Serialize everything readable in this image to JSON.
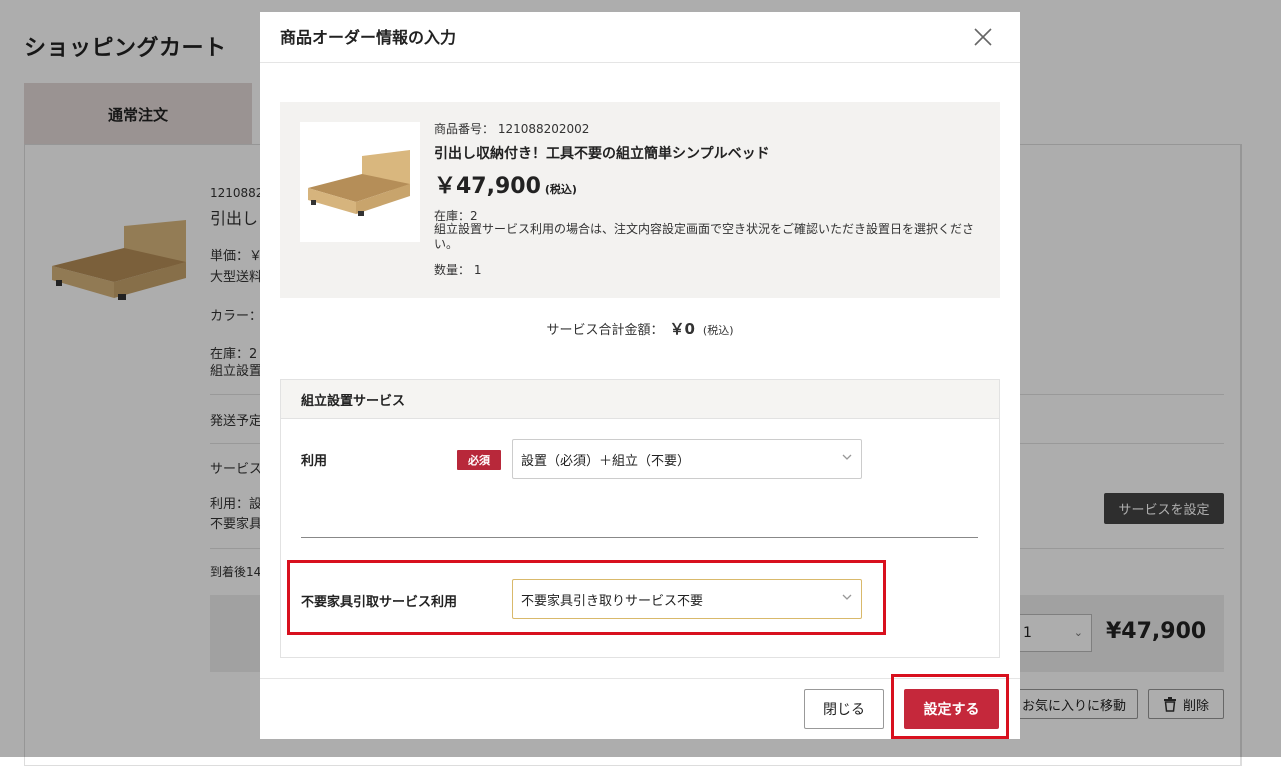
{
  "page": {
    "title": "ショッピングカート",
    "tab_normal": "通常注文",
    "item_number_partial": "1210882",
    "item_name_partial": "引出し",
    "unit_price_label": "単価：￥",
    "shipping_partial": "大型送料",
    "color_label": "カラー：",
    "stock_partial": "在庫：2",
    "assembly_partial": "組立設置",
    "ship_schedule_partial": "発送予定",
    "service_partial": "サービス",
    "usage_partial": "利用：設",
    "disposal_partial": "不要家具",
    "after_arrival_partial": "到着後14",
    "set_service_button": "サービスを設定",
    "qty_value": "1",
    "price": "¥47,900",
    "favorite_button": "お気に入りに移動",
    "delete_button": "削除"
  },
  "modal": {
    "title": "商品オーダー情報の入力",
    "product": {
      "number": "商品番号： 121088202002",
      "name": "引出し収納付き！工具不要の組立簡単シンプルベッド",
      "price": "￥47,900",
      "price_tax": "(税込)",
      "stock": "在庫：2",
      "note": "組立設置サービス利用の場合は、注文内容設定画面で空き状況をご確認いただき設置日を選択ください。",
      "qty": "数量： 1"
    },
    "service_total_label": "サービス合計金額：",
    "service_total_amount": "￥0",
    "service_total_tax": "(税込)",
    "service_section_title": "組立設置サービス",
    "usage_label": "利用",
    "required_badge": "必須",
    "usage_select_value": "設置（必須）＋組立（不要）",
    "disposal_label": "不要家具引取サービス利用",
    "disposal_select_value": "不要家具引き取りサービス不要",
    "close_button": "閉じる",
    "set_button": "設定する"
  },
  "colors": {
    "accent_red": "#c5283b",
    "required_badge": "#b8283a",
    "highlight_frame": "#d8101e",
    "tab_bg": "#e3d9d7"
  }
}
